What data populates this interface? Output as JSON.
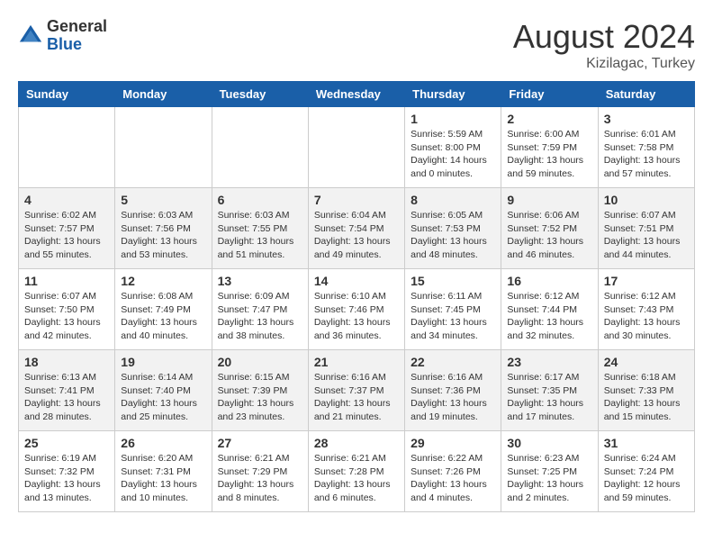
{
  "logo": {
    "general": "General",
    "blue": "Blue"
  },
  "title": {
    "month_year": "August 2024",
    "location": "Kizilagac, Turkey"
  },
  "days_of_week": [
    "Sunday",
    "Monday",
    "Tuesday",
    "Wednesday",
    "Thursday",
    "Friday",
    "Saturday"
  ],
  "weeks": [
    {
      "days": [
        {
          "number": "",
          "info": ""
        },
        {
          "number": "",
          "info": ""
        },
        {
          "number": "",
          "info": ""
        },
        {
          "number": "",
          "info": ""
        },
        {
          "number": "1",
          "info": "Sunrise: 5:59 AM\nSunset: 8:00 PM\nDaylight: 14 hours\nand 0 minutes."
        },
        {
          "number": "2",
          "info": "Sunrise: 6:00 AM\nSunset: 7:59 PM\nDaylight: 13 hours\nand 59 minutes."
        },
        {
          "number": "3",
          "info": "Sunrise: 6:01 AM\nSunset: 7:58 PM\nDaylight: 13 hours\nand 57 minutes."
        }
      ]
    },
    {
      "days": [
        {
          "number": "4",
          "info": "Sunrise: 6:02 AM\nSunset: 7:57 PM\nDaylight: 13 hours\nand 55 minutes."
        },
        {
          "number": "5",
          "info": "Sunrise: 6:03 AM\nSunset: 7:56 PM\nDaylight: 13 hours\nand 53 minutes."
        },
        {
          "number": "6",
          "info": "Sunrise: 6:03 AM\nSunset: 7:55 PM\nDaylight: 13 hours\nand 51 minutes."
        },
        {
          "number": "7",
          "info": "Sunrise: 6:04 AM\nSunset: 7:54 PM\nDaylight: 13 hours\nand 49 minutes."
        },
        {
          "number": "8",
          "info": "Sunrise: 6:05 AM\nSunset: 7:53 PM\nDaylight: 13 hours\nand 48 minutes."
        },
        {
          "number": "9",
          "info": "Sunrise: 6:06 AM\nSunset: 7:52 PM\nDaylight: 13 hours\nand 46 minutes."
        },
        {
          "number": "10",
          "info": "Sunrise: 6:07 AM\nSunset: 7:51 PM\nDaylight: 13 hours\nand 44 minutes."
        }
      ]
    },
    {
      "days": [
        {
          "number": "11",
          "info": "Sunrise: 6:07 AM\nSunset: 7:50 PM\nDaylight: 13 hours\nand 42 minutes."
        },
        {
          "number": "12",
          "info": "Sunrise: 6:08 AM\nSunset: 7:49 PM\nDaylight: 13 hours\nand 40 minutes."
        },
        {
          "number": "13",
          "info": "Sunrise: 6:09 AM\nSunset: 7:47 PM\nDaylight: 13 hours\nand 38 minutes."
        },
        {
          "number": "14",
          "info": "Sunrise: 6:10 AM\nSunset: 7:46 PM\nDaylight: 13 hours\nand 36 minutes."
        },
        {
          "number": "15",
          "info": "Sunrise: 6:11 AM\nSunset: 7:45 PM\nDaylight: 13 hours\nand 34 minutes."
        },
        {
          "number": "16",
          "info": "Sunrise: 6:12 AM\nSunset: 7:44 PM\nDaylight: 13 hours\nand 32 minutes."
        },
        {
          "number": "17",
          "info": "Sunrise: 6:12 AM\nSunset: 7:43 PM\nDaylight: 13 hours\nand 30 minutes."
        }
      ]
    },
    {
      "days": [
        {
          "number": "18",
          "info": "Sunrise: 6:13 AM\nSunset: 7:41 PM\nDaylight: 13 hours\nand 28 minutes."
        },
        {
          "number": "19",
          "info": "Sunrise: 6:14 AM\nSunset: 7:40 PM\nDaylight: 13 hours\nand 25 minutes."
        },
        {
          "number": "20",
          "info": "Sunrise: 6:15 AM\nSunset: 7:39 PM\nDaylight: 13 hours\nand 23 minutes."
        },
        {
          "number": "21",
          "info": "Sunrise: 6:16 AM\nSunset: 7:37 PM\nDaylight: 13 hours\nand 21 minutes."
        },
        {
          "number": "22",
          "info": "Sunrise: 6:16 AM\nSunset: 7:36 PM\nDaylight: 13 hours\nand 19 minutes."
        },
        {
          "number": "23",
          "info": "Sunrise: 6:17 AM\nSunset: 7:35 PM\nDaylight: 13 hours\nand 17 minutes."
        },
        {
          "number": "24",
          "info": "Sunrise: 6:18 AM\nSunset: 7:33 PM\nDaylight: 13 hours\nand 15 minutes."
        }
      ]
    },
    {
      "days": [
        {
          "number": "25",
          "info": "Sunrise: 6:19 AM\nSunset: 7:32 PM\nDaylight: 13 hours\nand 13 minutes."
        },
        {
          "number": "26",
          "info": "Sunrise: 6:20 AM\nSunset: 7:31 PM\nDaylight: 13 hours\nand 10 minutes."
        },
        {
          "number": "27",
          "info": "Sunrise: 6:21 AM\nSunset: 7:29 PM\nDaylight: 13 hours\nand 8 minutes."
        },
        {
          "number": "28",
          "info": "Sunrise: 6:21 AM\nSunset: 7:28 PM\nDaylight: 13 hours\nand 6 minutes."
        },
        {
          "number": "29",
          "info": "Sunrise: 6:22 AM\nSunset: 7:26 PM\nDaylight: 13 hours\nand 4 minutes."
        },
        {
          "number": "30",
          "info": "Sunrise: 6:23 AM\nSunset: 7:25 PM\nDaylight: 13 hours\nand 2 minutes."
        },
        {
          "number": "31",
          "info": "Sunrise: 6:24 AM\nSunset: 7:24 PM\nDaylight: 12 hours\nand 59 minutes."
        }
      ]
    }
  ]
}
